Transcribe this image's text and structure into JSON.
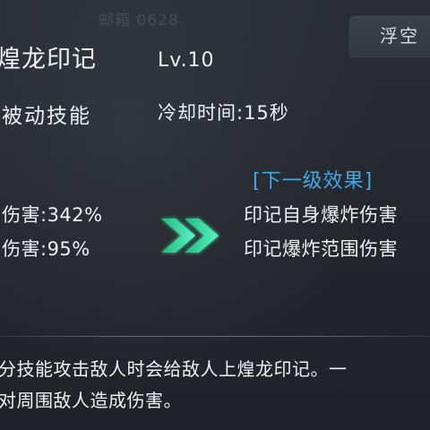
{
  "watermark": "邮箱 0628",
  "float_tab": {
    "label": "浮空"
  },
  "skill": {
    "name": "煌龙印记",
    "level": "Lv.10",
    "type": "被动技能",
    "cooldown": "冷却时间:15秒"
  },
  "current_effects": [
    {
      "text": "伤害:342%"
    },
    {
      "text": "伤害:95%"
    }
  ],
  "next_level": {
    "header": "[下一级效果]",
    "effects": [
      {
        "text": "印记自身爆炸伤害"
      },
      {
        "text": "印记爆炸范围伤害"
      }
    ]
  },
  "description": {
    "line1": "分技能攻击敌人时会给敌人上煌龙印记。一",
    "line2": "对周围敌人造成伤害。"
  },
  "icons": {
    "arrow": "double-chevron-right-icon"
  },
  "colors": {
    "accent_green": "#34e6a0",
    "header_blue": "#3fa9e6"
  }
}
